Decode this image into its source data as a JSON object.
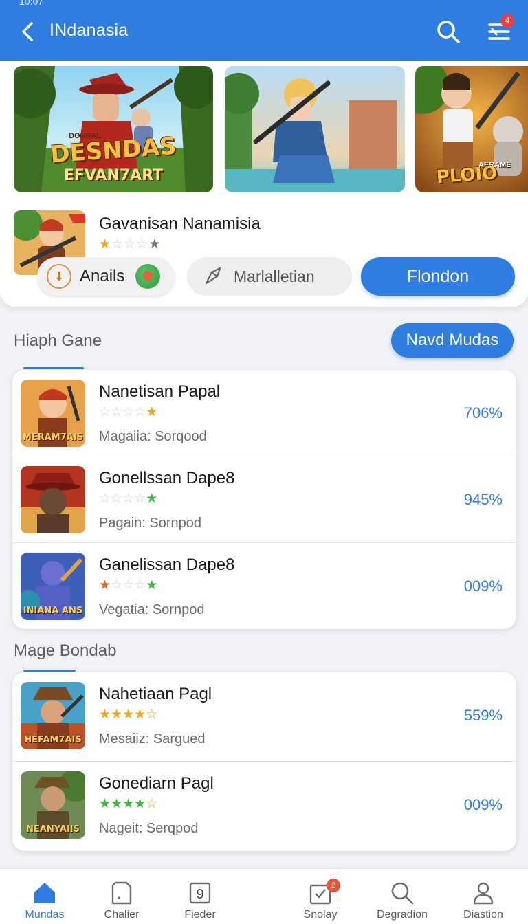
{
  "app_bar": {
    "status_time": "10:07",
    "title": "INdanasia",
    "notification_count": "4",
    "color": "#2f7de1"
  },
  "featured": {
    "banners": [
      {
        "top_text": "DONRAL",
        "logo": "DESNDAS",
        "sub": "EFVAN7ART"
      },
      {
        "top_text": "",
        "logo": "",
        "sub": ""
      },
      {
        "top_text": "AERAME",
        "logo": "PLOIO",
        "sub": ""
      }
    ],
    "app_name": "Gavanisan Nanamisia",
    "rating_stars": 1,
    "actions": {
      "left_label": "Anails",
      "middle_label": "Marlalletian",
      "primary_label": "Flondon"
    }
  },
  "section1": {
    "title": "Hiaph Gane",
    "button_label": "Navd Mudas",
    "items": [
      {
        "name": "Nanetisan Papal",
        "meta": "Magaiia: Sorqood",
        "percent": "706%",
        "thumb_tag": "MERAM7AIS",
        "stars": [
          "off",
          "off",
          "off",
          "off",
          "on-o"
        ]
      },
      {
        "name": "Gonellssan Dape8",
        "meta": "Pagain: Sornpod",
        "percent": "945%",
        "thumb_tag": "",
        "stars": [
          "off",
          "off",
          "off",
          "off",
          "on-g"
        ]
      },
      {
        "name": "Ganelissan Dape8",
        "meta": "Vegatia: Sornpod",
        "percent": "009%",
        "thumb_tag": "INIANA ANS",
        "stars": [
          "on-r",
          "off",
          "off",
          "off",
          "on-g"
        ]
      }
    ]
  },
  "section2": {
    "title": "Mage Bondab",
    "items": [
      {
        "name": "Nahetiaan Pagl",
        "meta": "Mesaiiz: Sargued",
        "percent": "559%",
        "thumb_tag": "HEFAM7AIS",
        "stars": [
          "on-o",
          "on-o",
          "on-o",
          "on-o",
          "on-o"
        ]
      },
      {
        "name": "Gonediarn Pagl",
        "meta": "Nageit: Serqpod",
        "percent": "009%",
        "thumb_tag": "NEANYAIIS",
        "stars": [
          "on-g",
          "on-g",
          "on-g",
          "on-g",
          "on-o"
        ]
      }
    ]
  },
  "bottom_nav": {
    "items": [
      {
        "label": "Mundas",
        "icon": "home-icon",
        "active": true
      },
      {
        "label": "Chalier",
        "icon": "document-icon"
      },
      {
        "label": "Fieder",
        "icon": "calendar-icon",
        "number": "9"
      },
      {
        "label": "Snolay",
        "icon": "inbox-check-icon",
        "badge": "2"
      },
      {
        "label": "Degradion",
        "icon": "search-icon"
      },
      {
        "label": "Diastion",
        "icon": "profile-icon"
      }
    ]
  }
}
